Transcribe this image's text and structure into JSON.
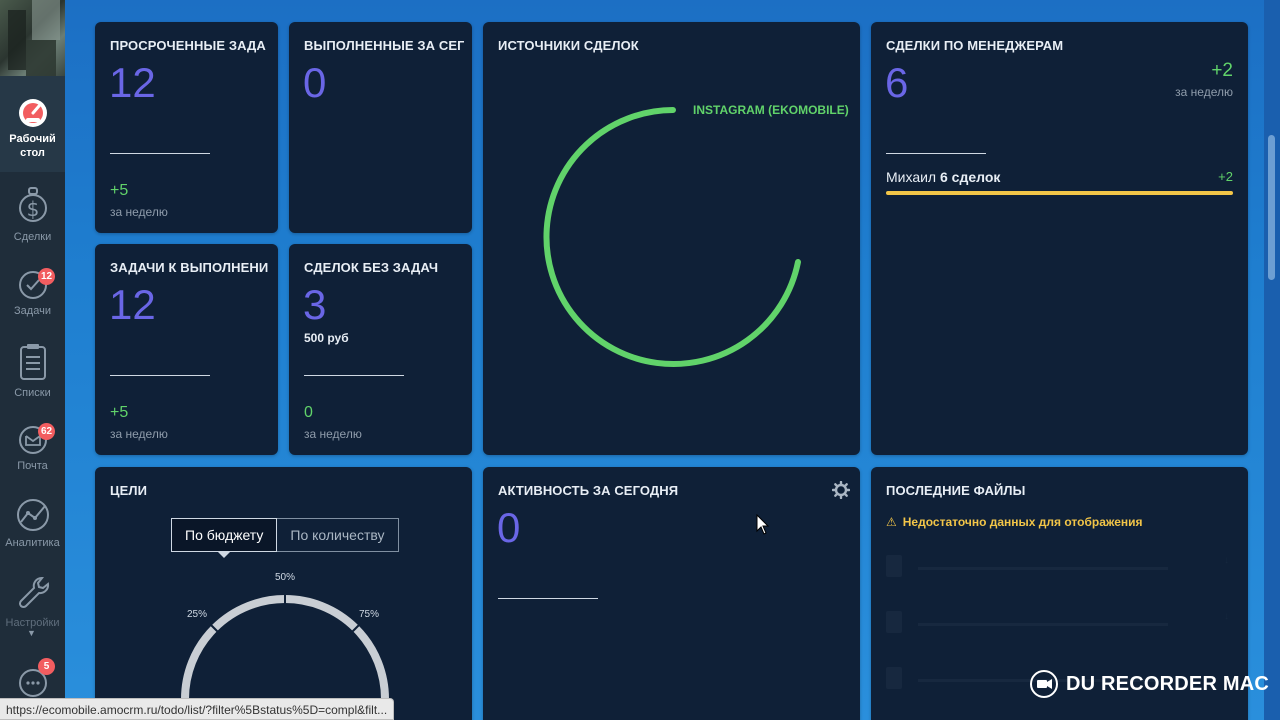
{
  "sidebar": {
    "items": [
      {
        "label": "Рабочий стол",
        "icon": "dashboard-gauge-icon",
        "active": true
      },
      {
        "label": "Сделки",
        "icon": "dollar-icon"
      },
      {
        "label": "Задачи",
        "icon": "check-circle-icon",
        "badge": "12"
      },
      {
        "label": "Списки",
        "icon": "list-icon"
      },
      {
        "label": "Почта",
        "icon": "mail-icon",
        "badge": "62"
      },
      {
        "label": "Аналитика",
        "icon": "analytics-icon"
      },
      {
        "label": "Настройки",
        "icon": "wrench-icon"
      },
      {
        "label": "",
        "icon": "chat-icon",
        "badge": "5"
      }
    ]
  },
  "cards": {
    "overdue": {
      "title": "ПРОСРОЧЕННЫЕ ЗАДА",
      "value": "12",
      "delta": "+5",
      "delta_label": "за неделю"
    },
    "completed": {
      "title": "ВЫПОЛНЕННЫЕ ЗА СЕГ",
      "value": "0"
    },
    "todo": {
      "title": "ЗАДАЧИ К ВЫПОЛНЕНИ",
      "value": "12",
      "delta": "+5",
      "delta_label": "за неделю"
    },
    "no_tasks": {
      "title": "СДЕЛОК БЕЗ ЗАДАЧ",
      "value": "3",
      "amount": "500 руб",
      "delta": "0",
      "delta_label": "за неделю"
    },
    "sources": {
      "title": "ИСТОЧНИКИ СДЕЛОК",
      "legend": "INSTAGRAM (EKOMOBILE)",
      "color": "#61d36a"
    },
    "managers": {
      "title": "СДЕЛКИ ПО МЕНЕДЖЕРАМ",
      "value": "6",
      "delta": "+2",
      "delta_label": "за неделю",
      "rows": [
        {
          "name": "Михаил",
          "count": "6 сделок",
          "delta": "+2",
          "bar_color": "#f2c548",
          "share": 1.0
        }
      ]
    },
    "goals": {
      "title": "ЦЕЛИ",
      "tabs": [
        "По бюджету",
        "По количеству"
      ],
      "active_tab": 0,
      "gauge_labels": {
        "p25": "25%",
        "p50": "50%",
        "p75": "75%"
      }
    },
    "activity": {
      "title": "АКТИВНОСТЬ ЗА СЕГОДНЯ",
      "value": "0"
    },
    "files": {
      "title": "ПОСЛЕДНИЕ ФАЙЛЫ",
      "warning": "Недостаточно данных для отображения"
    }
  },
  "status_url": "https://ecomobile.amocrm.ru/todo/list/?filter%5Bstatus%5D=compl&filt...",
  "watermark": "DU RECORDER MAC",
  "colors": {
    "accent_number": "#6a66e6",
    "positive": "#61d36a",
    "warning": "#f2c548",
    "card_bg": "#0f2037"
  }
}
